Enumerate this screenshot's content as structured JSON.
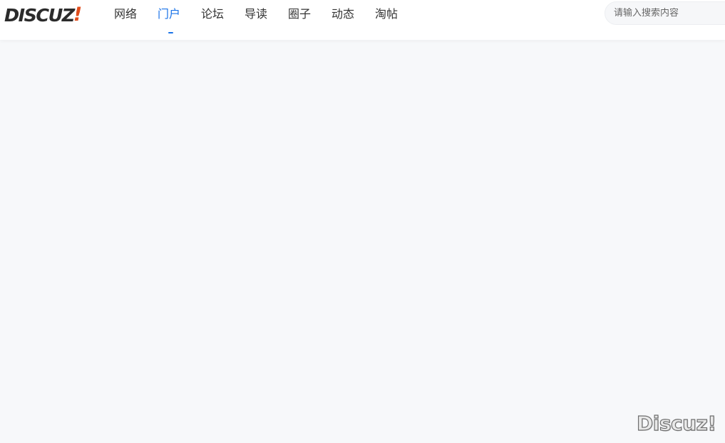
{
  "header": {
    "logo_text": "DISCUZ",
    "logo_mark": "!",
    "nav": [
      {
        "label": "网络",
        "active": false
      },
      {
        "label": "门户",
        "active": true
      },
      {
        "label": "论坛",
        "active": false
      },
      {
        "label": "导读",
        "active": false
      },
      {
        "label": "圈子",
        "active": false
      },
      {
        "label": "动态",
        "active": false
      },
      {
        "label": "淘帖",
        "active": false
      }
    ],
    "search_placeholder": "请输入搜索内容"
  },
  "watermark": "Discuz!",
  "colors": {
    "accent": "#1a73e8",
    "logo_mark": "#e14d1c",
    "page_background": "#f7f8fa"
  }
}
